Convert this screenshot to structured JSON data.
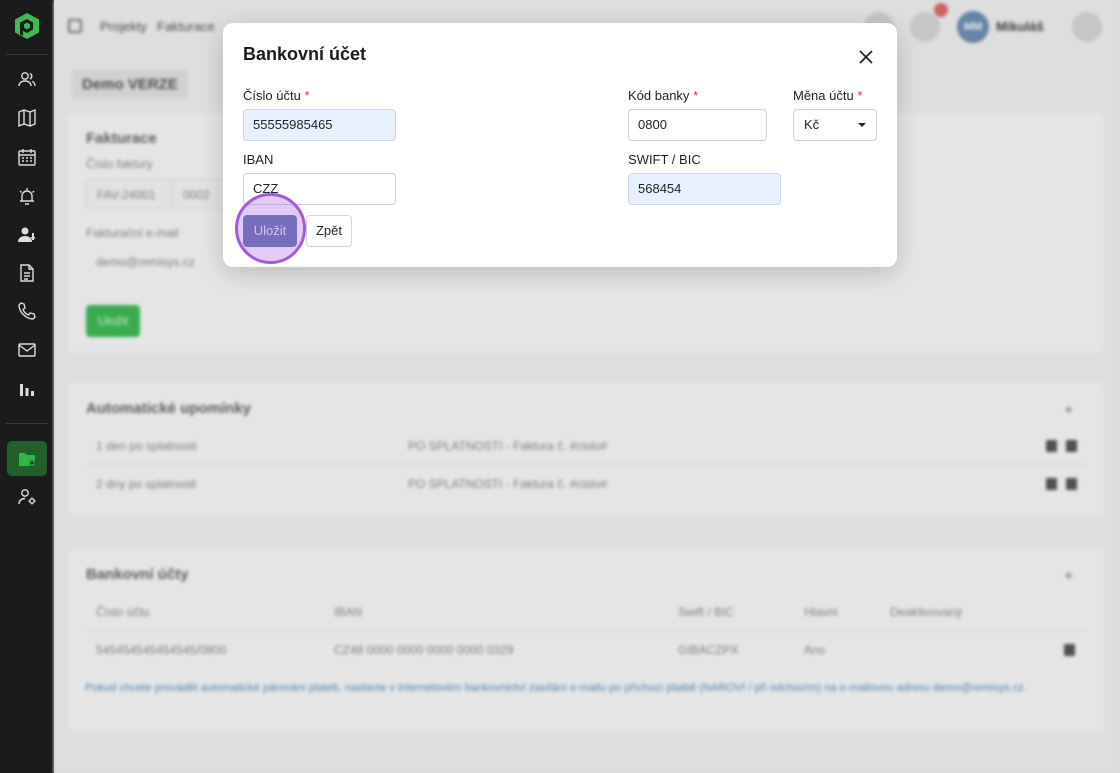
{
  "breadcrumb": [
    "Projekty",
    "Fakturace"
  ],
  "user": {
    "initials": "MM",
    "name": "Mikuláš"
  },
  "page_chip": "Demo VERZE",
  "billing_card": {
    "title": "Fakturace",
    "invoice_number_label": "Číslo faktury",
    "invoice_prefix": "FAV-24001",
    "invoice_seq": "0002",
    "billing_email_label": "Fakturační e-mail",
    "billing_email": "demo@remisys.cz",
    "save_label": "Uložit"
  },
  "reminders_card": {
    "title": "Automatické upomínky",
    "rows": [
      {
        "when": "1 den po splatnosti",
        "template": "PO SPLATNOSTI - Faktura č. #cislo#"
      },
      {
        "when": "2 dny po splatnosti",
        "template": "PO SPLATNOSTI - Faktura č. #cislo#"
      }
    ]
  },
  "bank_card": {
    "title": "Bankovní účty",
    "columns": [
      "Číslo účtu",
      "IBAN",
      "Swift / BIC",
      "Hlavní",
      "Deaktivovaný"
    ],
    "rows": [
      {
        "account": "545454545454545/0800",
        "iban": "CZ48 0000 0000 0000 0000 0329",
        "swift": "GIBACZPX",
        "main": "Ano"
      }
    ],
    "note": "Pokud chcete provádět automatické párování plateb, nastavte v internetovém bankovnictví zasílání e-mailu po příchozí platbě (NAROVI / při odchozím) na e-mailovou adresu demo@remisys.cz."
  },
  "modal": {
    "title": "Bankovní účet",
    "account_label": "Číslo účtu",
    "account_value": "55555985465",
    "bank_code_label": "Kód banky",
    "bank_code_value": "0800",
    "currency_label": "Měna účtu",
    "currency_value": "Kč",
    "iban_label": "IBAN",
    "iban_value": "CZZ",
    "swift_label": "SWIFT / BIC",
    "swift_value": "568454",
    "required_mark": "*",
    "save_label": "Uložit",
    "back_label": "Zpět"
  },
  "colors": {
    "accent": "#5f73a8",
    "sidebar": "#1b1b1b",
    "active_green": "#2fb84a",
    "click_marker": "#a05bdc"
  },
  "icons": [
    "logo-icon",
    "users-icon",
    "map-icon",
    "calendar-icon",
    "alarm-icon",
    "user-key-icon",
    "document-icon",
    "phone-icon",
    "mail-icon",
    "chart-icon",
    "folder-icon",
    "user-settings-icon",
    "close-icon",
    "caret-down-icon"
  ]
}
